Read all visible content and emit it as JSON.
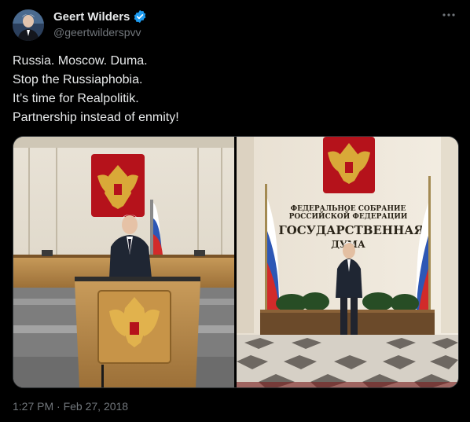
{
  "author": {
    "name": "Geert Wilders",
    "handle": "@geertwilderspvv",
    "verified_badge": "verified-check-icon"
  },
  "more_icon": "more-horizontal-icon",
  "tweet_lines": [
    "Russia. Moscow. Duma.",
    "Stop the Russiaphobia.",
    "It’s time for Realpolitik.",
    "Partnership instead of enmity!"
  ],
  "photo_right_sign": {
    "line1": "ФЕДЕРАЛЬНОЕ СОБРАНИЕ",
    "line2": "РОССИЙСКОЙ ФЕДЕРАЦИИ",
    "line3": "ГОСУДАРСТВЕННАЯ",
    "line4": "ДУМА"
  },
  "timestamp": "1:27 PM · Feb 27, 2018",
  "colors": {
    "background": "#000000",
    "text_primary": "#e7e9ea",
    "text_secondary": "#71767b",
    "verified": "#1d9bf0",
    "border": "#2f3336"
  }
}
